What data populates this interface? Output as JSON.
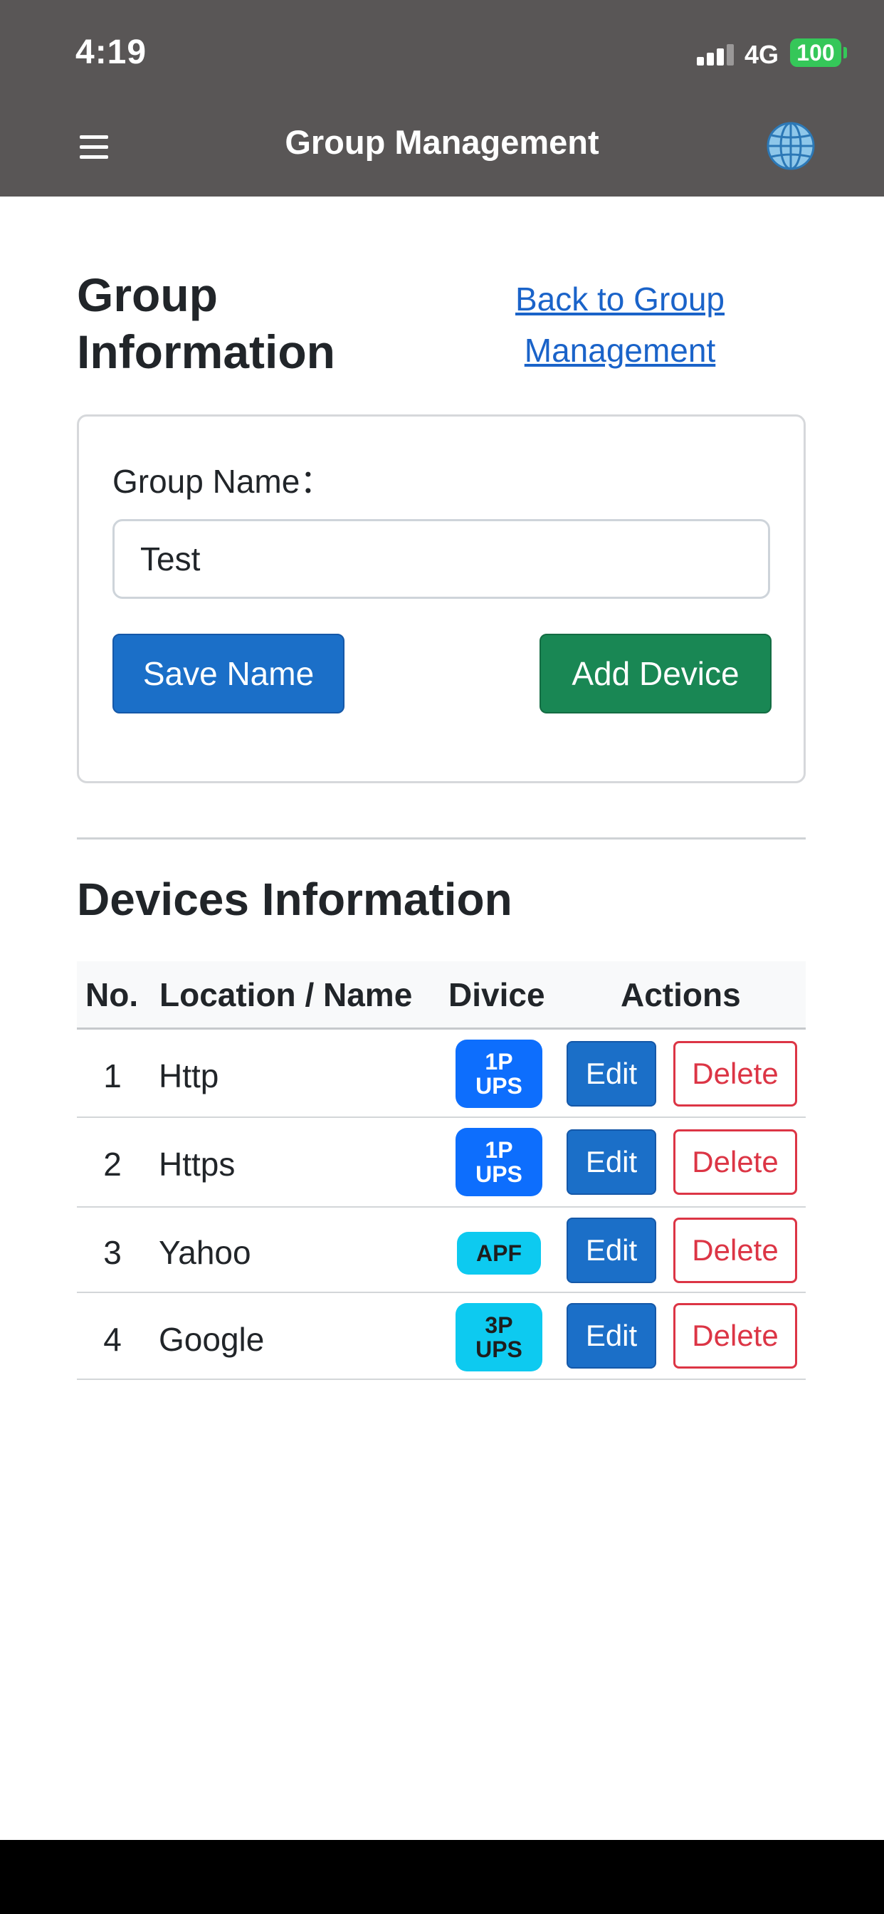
{
  "status_bar": {
    "time": "4:19",
    "network": "4G",
    "battery": "100"
  },
  "header": {
    "title": "Group Management",
    "menu_icon": "hamburger-menu-icon",
    "language_icon": "globe-icon"
  },
  "page": {
    "title": "Group Information",
    "back_link": "Back to Group Management"
  },
  "group_form": {
    "label": "Group Name：",
    "value": "Test",
    "save_label": "Save Name",
    "add_label": "Add Device"
  },
  "devices": {
    "title": "Devices Information",
    "columns": {
      "no": "No.",
      "name": "Location / Name",
      "device": "Divice",
      "actions": "Actions"
    },
    "rows": [
      {
        "no": "1",
        "name": "Http",
        "device_line1": "1P",
        "device_line2": "UPS",
        "edit": "Edit",
        "delete": "Delete"
      },
      {
        "no": "2",
        "name": "Https",
        "device_line1": "1P",
        "device_line2": "UPS",
        "edit": "Edit",
        "delete": "Delete"
      },
      {
        "no": "3",
        "name": "Yahoo",
        "device_line1": "APF",
        "device_line2": "",
        "edit": "Edit",
        "delete": "Delete"
      },
      {
        "no": "4",
        "name": "Google",
        "device_line1": "3P",
        "device_line2": "UPS",
        "edit": "Edit",
        "delete": "Delete"
      }
    ]
  },
  "colors": {
    "header_bg": "#595656",
    "primary": "#1b6fc8",
    "success": "#198754",
    "danger": "#dc3545",
    "badge_blue": "#0d6efd",
    "badge_cyan": "#0dcaf0"
  }
}
